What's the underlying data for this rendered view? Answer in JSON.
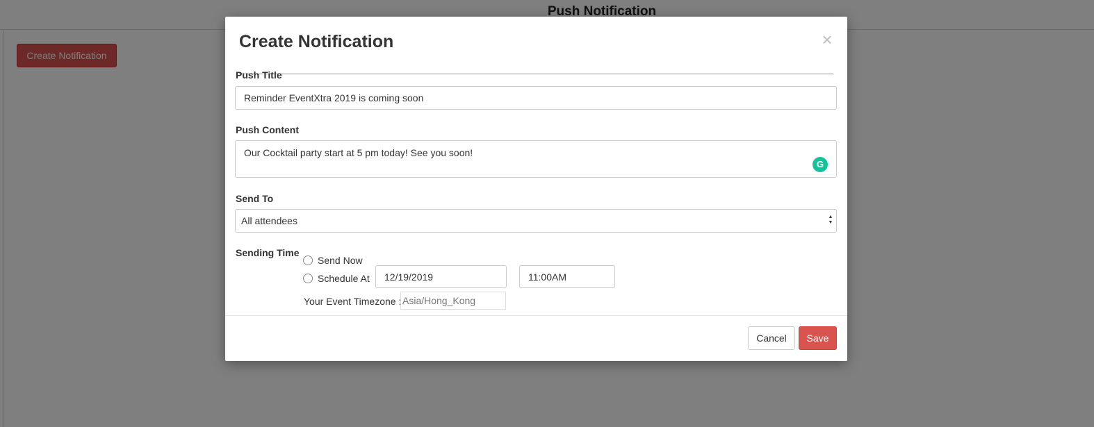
{
  "page": {
    "title": "Push Notification",
    "create_button_label": "Create Notification"
  },
  "modal": {
    "title": "Create Notification",
    "close_glyph": "×",
    "push_title": {
      "label": "Push Title",
      "value": "Reminder EventXtra 2019 is coming soon"
    },
    "push_content": {
      "label": "Push Content",
      "value": "Our Cocktail party start at 5 pm today! See you soon!",
      "grammarly_icon": "grammarly-icon"
    },
    "send_to": {
      "label": "Send To",
      "selected": "All attendees"
    },
    "sending_time": {
      "label": "Sending Time",
      "send_now_label": "Send Now",
      "schedule_at_label": "Schedule At",
      "date_value": "12/19/2019",
      "time_value": "11:00AM",
      "timezone_label": "Your Event Timezone :",
      "timezone_value": "Asia/Hong_Kong"
    },
    "footer": {
      "cancel_label": "Cancel",
      "save_label": "Save"
    }
  },
  "colors": {
    "primary_danger": "#d9534f",
    "backdrop": "rgba(0,0,0,0.5)",
    "grammarly": "#15c39a"
  }
}
